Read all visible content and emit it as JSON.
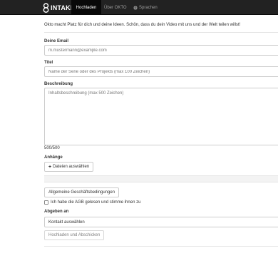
{
  "navbar": {
    "brand": "INTAKE",
    "items": [
      {
        "label": "Hochladen"
      },
      {
        "label": "Über OKTO"
      },
      {
        "label": "Sprachen"
      }
    ]
  },
  "intro": "Okto macht Platz für dich und deine Ideen. Schön, dass du dein Video mit uns und der Welt teilen willst!",
  "form": {
    "email_label": "Deine Email",
    "email_placeholder": "m.mustermann@example.com",
    "title_label": "Titel",
    "title_placeholder": "Name der Serie oder des Projekts (max 100 Zeichen)",
    "description_label": "Beschreibung",
    "description_placeholder": "Inhaltsbeschreibung (max 500 Zeichen)",
    "char_counter": "500/500",
    "attachments_label": "Anhänge",
    "choose_files_label": "Dateien auswählen",
    "terms_button": "Allgemeine Geschäftsbedingungen",
    "terms_checkbox_label": "Ich habe die AGB gelesen und stimme ihnen zu",
    "submit_to_label": "Abgeben an",
    "contact_select_value": "Kontakt auswählen",
    "submit_button": "Hochladen und Abschicken"
  }
}
